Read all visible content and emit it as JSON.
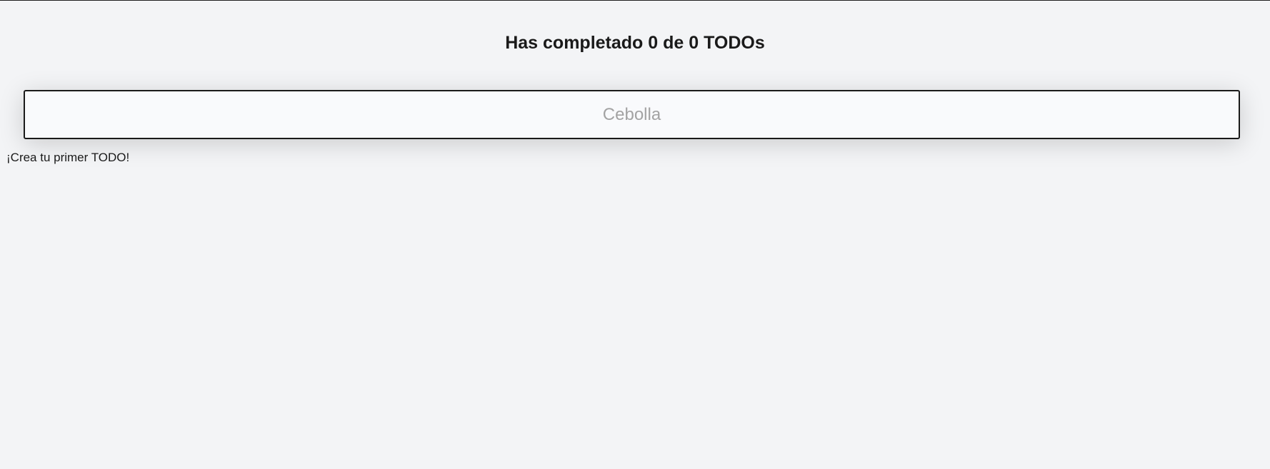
{
  "header": {
    "title": "Has completado 0 de 0 TODOs",
    "completed_count": 0,
    "total_count": 0
  },
  "todo_input": {
    "value": "",
    "placeholder": "Cebolla"
  },
  "todo_list": {
    "items": [],
    "empty_message": "¡Crea tu primer TODO!"
  },
  "colors": {
    "background": "#f3f4f6",
    "input_background": "#f9fafc",
    "text": "#1a1a1a",
    "placeholder": "#a3a3a3",
    "border": "#1a1a1a"
  }
}
